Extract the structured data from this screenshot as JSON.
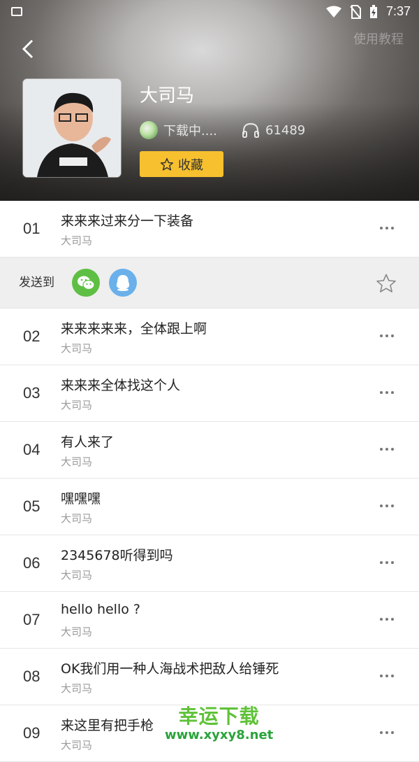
{
  "status_bar": {
    "time": "7:37"
  },
  "header": {
    "tutorial_label": "使用教程",
    "album_title": "大司马",
    "uploader": "下载中....",
    "play_count": "61489",
    "favorite_label": "收藏"
  },
  "share_bar": {
    "label": "发送到"
  },
  "tracks": [
    {
      "num": "01",
      "name": "来来来过来分一下装备",
      "artist": "大司马"
    },
    {
      "num": "02",
      "name": "来来来来来，全体跟上啊",
      "artist": "大司马"
    },
    {
      "num": "03",
      "name": "来来来全体找这个人",
      "artist": "大司马"
    },
    {
      "num": "04",
      "name": "有人来了",
      "artist": "大司马"
    },
    {
      "num": "05",
      "name": "嘿嘿嘿",
      "artist": "大司马"
    },
    {
      "num": "06",
      "name": "2345678听得到吗",
      "artist": "大司马"
    },
    {
      "num": "07",
      "name": "hello hello ?",
      "artist": "大司马"
    },
    {
      "num": "08",
      "name": "OK我们用一种人海战术把敌人给锤死",
      "artist": "大司马"
    },
    {
      "num": "09",
      "name": "来这里有把手枪",
      "artist": "大司马"
    }
  ],
  "watermark": {
    "title": "幸运下载",
    "url": "www.xyxy8.net"
  }
}
